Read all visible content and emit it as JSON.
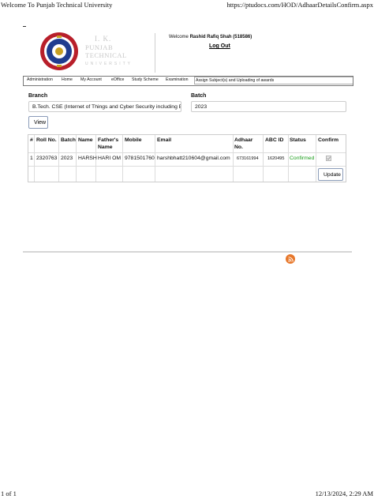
{
  "print": {
    "title": "Welcome To Punjab Technical University",
    "url": "https://ptudocs.com/HOD/AdhaarDetailsConfirm.aspx",
    "page_count": "1 of 1",
    "datetime": "12/13/2024, 2:29 AM"
  },
  "header": {
    "logo_line1": "I. K.",
    "logo_line2": "PUNJAB TECHNICAL",
    "logo_line3": "UNIVERSITY",
    "welcome_prefix": "Welcome",
    "user_name": "Rashid Rafiq Shah (518586)",
    "logout": "Log Out"
  },
  "nav": {
    "items": [
      "Administration",
      "Home",
      "My Account",
      "eOffice",
      "Study Scheme",
      "Examination",
      "Assign Subject(s) and Uploading of awards"
    ]
  },
  "form": {
    "branch_label": "Branch",
    "branch_value": "B.Tech. CSE (Internet of Things and Cyber Security including E",
    "batch_label": "Batch",
    "batch_value": "2023",
    "view_button": "View"
  },
  "table": {
    "headers": [
      "#",
      "Roll No.",
      "Batch",
      "Name",
      "Father's Name",
      "Mobile",
      "Email",
      "Adhaar No.",
      "ABC ID",
      "Status",
      "Confirm"
    ],
    "rows": [
      {
        "index": "1",
        "roll_no": "2320763",
        "batch": "2023",
        "name": "HARSH",
        "father_name": "HARI OM",
        "mobile": "9781501760",
        "email": "harshbhatt210604@gmail.com",
        "adhaar": "673161994",
        "abc_id": "1620495",
        "status": "Confirmed",
        "confirm_checked": true
      }
    ],
    "update_button": "Update"
  },
  "colors": {
    "status_confirmed": "#1a9c1a",
    "rss": "#e7772a"
  }
}
